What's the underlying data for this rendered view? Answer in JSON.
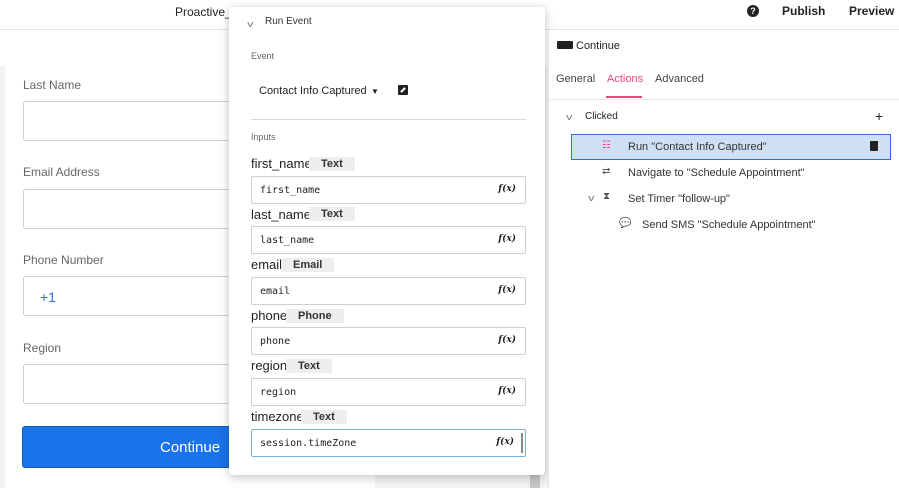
{
  "topbar": {
    "app_title": "Proactive_S",
    "publish_label": "Publish",
    "preview_label": "Preview"
  },
  "form": {
    "fields": [
      {
        "label": "Last Name"
      },
      {
        "label": "Email Address"
      },
      {
        "label": "Phone Number",
        "prefix": "+1"
      },
      {
        "label": "Region"
      }
    ],
    "continue_label": "Continue"
  },
  "popup": {
    "title": "Run Event",
    "event_label": "Event",
    "event_value": "Contact Info Captured",
    "inputs_label": "Inputs",
    "inputs": [
      {
        "name": "first_name",
        "type": "Text",
        "value": "first_name"
      },
      {
        "name": "last_name",
        "type": "Text",
        "value": "last_name"
      },
      {
        "name": "email",
        "type": "Email",
        "value": "email"
      },
      {
        "name": "phone",
        "type": "Phone",
        "value": "phone"
      },
      {
        "name": "region",
        "type": "Text",
        "value": "region"
      },
      {
        "name": "timezone",
        "type": "Text",
        "value": "session.timeZone"
      }
    ],
    "fx_label": "f(x)"
  },
  "panel": {
    "component_name": "Continue",
    "tabs": [
      "General",
      "Actions",
      "Advanced"
    ],
    "active_tab": "Actions",
    "trigger": "Clicked",
    "actions": [
      {
        "label": "Run \"Contact Info Captured\"",
        "icon": "rss-icon",
        "selected": true
      },
      {
        "label": "Navigate to \"Schedule Appointment\"",
        "icon": "navigate-icon"
      },
      {
        "label": "Set Timer \"follow-up\"",
        "icon": "timer-icon"
      },
      {
        "label": "Send SMS \"Schedule Appointment\"",
        "icon": "sms-icon"
      }
    ]
  },
  "colors": {
    "accent_pink": "#e8467c",
    "primary_blue": "#1a73e8",
    "selection_bg": "#cfe0f4"
  }
}
